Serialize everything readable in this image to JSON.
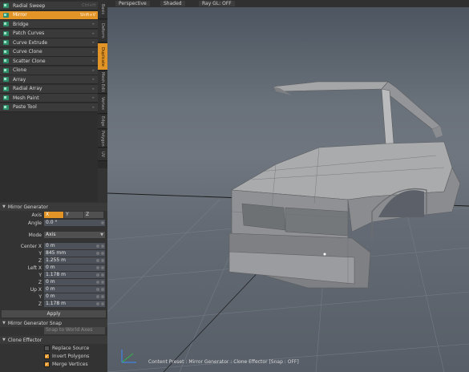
{
  "toolbox": {
    "items": [
      {
        "label": "Radial Sweep",
        "shortcut": "Ctrl+H",
        "icon": "radial-sweep-icon"
      },
      {
        "label": "Mirror",
        "shortcut": "Shift+V",
        "icon": "mirror-icon",
        "active": true
      },
      {
        "label": "Bridge",
        "icon": "bridge-icon"
      },
      {
        "label": "Patch Curves",
        "icon": "patch-curves-icon"
      },
      {
        "label": "Curve Extrude",
        "icon": "curve-extrude-icon"
      },
      {
        "label": "Curve Clone",
        "icon": "curve-clone-icon"
      },
      {
        "label": "Scatter Clone",
        "icon": "scatter-clone-icon"
      },
      {
        "label": "Clone",
        "icon": "clone-icon"
      },
      {
        "label": "Array",
        "icon": "array-icon"
      },
      {
        "label": "Radial Array",
        "icon": "radial-array-icon"
      },
      {
        "label": "Mesh Paint",
        "icon": "mesh-paint-icon"
      },
      {
        "label": "Paste Tool",
        "icon": "paste-tool-icon"
      }
    ]
  },
  "side_tabs": [
    "Basic",
    "Deform",
    "Duplicate",
    "Mesh Edit",
    "Vertex",
    "Edge",
    "Polygon",
    "UV"
  ],
  "side_tab_active": "Duplicate",
  "mirror_generator": {
    "title": "Mirror Generator",
    "axis_label": "Axis",
    "axes": [
      "X",
      "Y",
      "Z"
    ],
    "axis_selected": "X",
    "angle_label": "Angle",
    "angle_value": "0.0 °",
    "mode_label": "Mode",
    "mode_value": "Axis",
    "center_label": "Center X",
    "center_x": "0 m",
    "center_y": "845 mm",
    "center_z": "1.255 m",
    "left_label": "Left X",
    "left_x": "0 m",
    "left_y": "1.178 m",
    "left_z": "0 m",
    "up_label": "Up X",
    "up_x": "0 m",
    "up_y": "0 m",
    "up_z": "1.178 m",
    "y_label": "Y",
    "z_label": "Z",
    "apply_label": "Apply"
  },
  "mirror_snap": {
    "title": "Mirror Generator Snap",
    "snap_label": "Snap to World Axes",
    "snap_checked": false
  },
  "clone_effector": {
    "title": "Clone Effector",
    "options": [
      {
        "label": "Replace Source",
        "checked": false
      },
      {
        "label": "Invert Polygons",
        "checked": true
      },
      {
        "label": "Merge Vertices",
        "checked": true
      }
    ]
  },
  "viewport": {
    "buttons": [
      "Perspective",
      "Shaded",
      "Ray GL: OFF"
    ],
    "status": "Content Preset : Mirror Generator : Clone Effector   [Snap : OFF]"
  },
  "colors": {
    "accent": "#e39426",
    "panel": "#333333",
    "field": "#4d525a"
  }
}
